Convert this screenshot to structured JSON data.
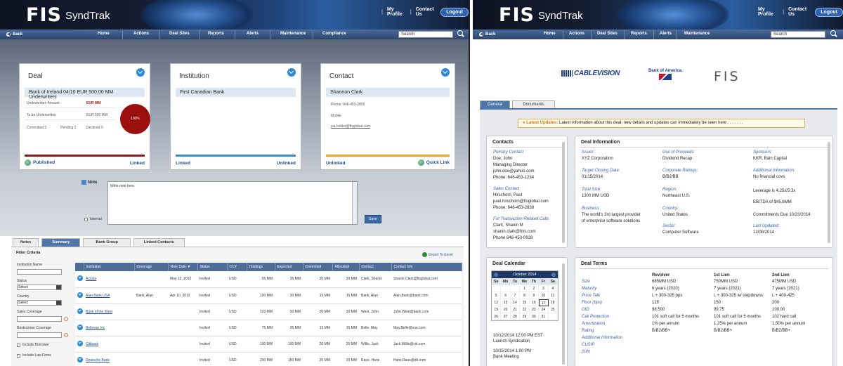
{
  "left": {
    "header": {
      "logo_fis": "FIS",
      "logo_name": "SyndTrak",
      "my_profile": "My Profile",
      "contact_us": "Contact Us",
      "logout": "Logout"
    },
    "nav": {
      "back": "Back",
      "items": [
        "Home",
        "Actions",
        "Deal Sites",
        "Reports",
        "Alerts",
        "Maintenance",
        "Compliance"
      ],
      "search_placeholder": "Search"
    },
    "deal": {
      "title": "Deal",
      "name": "Bank of Ireland 04/10 EUR 500.00 MM Underwriters",
      "underwritten_label": "Underwritten Amount",
      "underwritten_value": "EUR MM",
      "to_be_label": "To be Underwritten",
      "to_be_value": "EUR 500 MM",
      "committed": "Committed 0",
      "pending": "Pending 2",
      "declined": "Declined 0",
      "pie_label": "100%",
      "status": "Published",
      "link": "Linked",
      "accent": "#8b1a1a"
    },
    "institution": {
      "title": "Institution",
      "name": "First Canadian Bank",
      "left": "Linked",
      "right": "Unlinked",
      "accent": "#3d8bc4"
    },
    "contact": {
      "title": "Contact",
      "name": "Shannon Clark",
      "phone": "Phone: 646-453-2855",
      "mobile": "Mobile",
      "email": "sia.holder@fisglobal.com",
      "left": "Unlinked",
      "right": "Quick Link",
      "accent": "#e8a531"
    },
    "note": {
      "label": "Note",
      "placeholder": "Write note here.",
      "internal": "Internal",
      "save": "Save"
    },
    "tabs": [
      "Notes",
      "Summary",
      "Bank Group",
      "Linked Contacts"
    ],
    "filter": {
      "title": "Filter Criteria",
      "institution_name": "Institution Name",
      "status": "Status",
      "status_value": "Select",
      "country": "Country",
      "country_value": "Select",
      "sales_coverage": "Sales Coverage",
      "bookrunner_coverage": "Bookrunner Coverage",
      "include_borrower": "Include Borrower",
      "include_law_firms": "Include Law Firms",
      "export": "Export To Excel"
    },
    "table": {
      "headers": [
        "Institution",
        "Coverage",
        "Note Date ▼",
        "Status",
        "CCY",
        "Holdings",
        "Expected",
        "Commited",
        "Allocated",
        "Contact",
        "Contact Info"
      ],
      "rows": [
        [
          "Acosta",
          "",
          "May 12, 2012",
          "Invited",
          "USD",
          "55 MM",
          "35 MM",
          "20 MM",
          "20 MM",
          "Clark, Shanin",
          "Shanin.Clark@fisglobal.com"
        ],
        [
          "Alan Bank USA",
          "Bank, Alan",
          "Apr 10, 2012",
          "Invited",
          "USD",
          "100 MM",
          "30 MM",
          "15 MM",
          "15 MM",
          "Bank, Alan",
          "Alan.Bank@bank.com"
        ],
        [
          "Bank of the West",
          "",
          "",
          "Invited",
          "USD",
          "123 MM",
          "50 MM",
          "20 MM",
          "20 MM",
          "West, John",
          "John.West@bank.com"
        ],
        [
          "Bellevue Inc",
          "",
          "",
          "Invited",
          "USD",
          "75 MM",
          "25 MM",
          "15 MM",
          "15 MM",
          "Belle, May",
          "May.Belle@vue.com"
        ],
        [
          "Citibank",
          "",
          "",
          "Invited",
          "USD",
          "100 MM",
          "100 MM",
          "20 MM",
          "20 MM",
          "Willis, Jack",
          "Jack.Willis@citi.com"
        ],
        [
          "Deutsche Bank",
          "",
          "",
          "Invited",
          "USD",
          "200 MM",
          "150 MM",
          "20 MM",
          "20 MM",
          "Raus, Hans",
          "Hans.Raus@db.com"
        ]
      ]
    }
  },
  "right": {
    "header": {
      "logo_fis": "FIS",
      "logo_name": "SyndTrak",
      "my_profile": "My Profile",
      "contact_us": "Contact Us",
      "logout": "Logout"
    },
    "nav": {
      "back": "Back",
      "items": [
        "Home",
        "Actions",
        "Deal Sites",
        "Reports",
        "Alerts",
        "Maintenance"
      ],
      "search_placeholder": "Search"
    },
    "logos": {
      "cablevision": "CABLEVISION",
      "boa": "Bank of America.",
      "fis": "FIS"
    },
    "tabs": [
      "General",
      "Documents"
    ],
    "updates": {
      "label": "Latest Updates:",
      "text": "Latest information about this deal, new details and updates can immediately be seen here . . . . . . ."
    },
    "contacts": {
      "title": "Contacts",
      "primary_label": "Primary Contact",
      "primary": [
        "Doe, John",
        "Managing Director",
        "john.doe@yahoo.com",
        "Phone: 646-453-1234"
      ],
      "sales_label": "Sales Contact",
      "sales": [
        "Hirschorn, Paul",
        "paul.hirschorn@fisglobal.com",
        "Phone: 646-453-2838"
      ],
      "tx_label": "For Transaction-Related Calls",
      "tx": [
        "Clark, Shanin M",
        "shanin.clark@fnis.com",
        "Phone 646-453-0928"
      ]
    },
    "deal_info": {
      "title": "Deal Information",
      "issuer_l": "Issuer:",
      "issuer": "XYZ Corporation",
      "uop_l": "Use of Proceeds:",
      "uop": "Dividend Recap",
      "sponsors_l": "Sponsors:",
      "sponsors": "KKR, Bain Capital",
      "tcd_l": "Target Closing Date:",
      "tcd": "01/15/2014",
      "cr_l": "Corporate Ratings:",
      "cr": "B/B2/BB",
      "ai_l": "Additional Information:",
      "ai": "No financial covs",
      "ts_l": "Total Size:",
      "ts": "1300 MM USD",
      "region_l": "Region:",
      "region": "Northeast U.S.",
      "leverage": "Leverage is 4.25x/5.3x",
      "ebitda": "EBITDA of $45.6MM",
      "business_l": "Business:",
      "business1": "The world's 3rd largest provider",
      "business2": "of enterprise software solutions",
      "country_l": "Country:",
      "country": "United States",
      "commitments": "Commitments Due 10/23/2014",
      "sector_l": "Sector:",
      "sector": "Computer Software",
      "lu_l": "Last Updated:",
      "lu": "12/08/2014"
    },
    "calendar": {
      "title": "Deal Calendar",
      "month": "October 2014",
      "days": [
        "Su",
        "Mo",
        "Tu",
        "We",
        "Th",
        "Fr",
        "Sa"
      ],
      "cells": [
        "",
        "",
        "",
        "1",
        "2",
        "3",
        "4",
        "5",
        "6",
        "7",
        "8",
        "9",
        "10",
        "11",
        "12",
        "13",
        "14",
        "15",
        "16",
        "17",
        "18",
        "19",
        "20",
        "21",
        "22",
        "23",
        "24",
        "25",
        "26",
        "27",
        "28",
        "29",
        "30",
        "31",
        ""
      ],
      "events": [
        "10/12/2014 12:00 PM EST",
        "Launch Syndication",
        "10/15/2014 1:00 PM",
        "Bank Meeting"
      ]
    },
    "terms": {
      "title": "Deal Terms",
      "cols": [
        "Revolver",
        "1st Lien",
        "2nd Lien"
      ],
      "rows": [
        {
          "label": "Size",
          "v": [
            "685MM USD",
            "750MM USD",
            "475MM USD"
          ]
        },
        {
          "label": "Maturity",
          "v": [
            "6 years (2020)",
            "7 years (2021)",
            "7 years (2021)"
          ]
        },
        {
          "label": "Price Talk",
          "v": [
            "L + 300-325 bps",
            "L + 300-325 w/ stepdowns",
            "L + 400-425"
          ]
        },
        {
          "label": "Floor (bps)",
          "v": [
            "125",
            "150",
            "200"
          ]
        },
        {
          "label": "OID",
          "v": [
            "98.500",
            "99.75",
            "100.00"
          ]
        },
        {
          "label": "Call Protection",
          "v": [
            "101 soft call for 6 months",
            "101 soft call for 6 months",
            "102 hard call"
          ]
        },
        {
          "label": "Amortization",
          "v": [
            "1% per annum",
            "1.25% per annum",
            "1.50% per annum"
          ]
        },
        {
          "label": "Rating",
          "v": [
            "B/B2/BB+",
            "B/B2/BB+",
            "B/B2/BB+"
          ]
        },
        {
          "label": "Additional Information",
          "v": [
            "",
            "",
            ""
          ]
        },
        {
          "label": "CUSIP",
          "v": [
            "",
            "",
            ""
          ]
        },
        {
          "label": "ISIN",
          "v": [
            "",
            "",
            ""
          ]
        }
      ]
    }
  }
}
